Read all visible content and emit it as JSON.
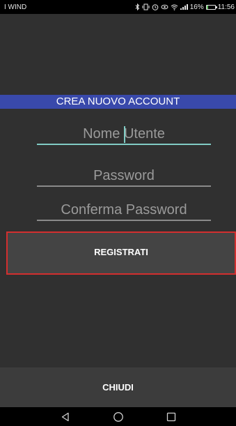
{
  "status_bar": {
    "carrier": "I WIND",
    "battery_percent": "16%",
    "battery_level": 0.16,
    "time": "11:56",
    "icons": [
      "bluetooth-icon",
      "vibrate-icon",
      "alarm-icon",
      "eye-comfort-icon",
      "wifi-icon",
      "signal-icon",
      "battery-icon"
    ]
  },
  "form": {
    "title": "CREA NUOVO ACCOUNT",
    "username_placeholder": "Nome Utente",
    "password_placeholder": "Password",
    "confirm_password_placeholder": "Conferma Password",
    "register_label": "REGISTRATI"
  },
  "footer": {
    "close_label": "CHIUDI"
  },
  "nav": {
    "icons": [
      "back-icon",
      "home-icon",
      "recents-icon"
    ]
  },
  "colors": {
    "banner": "#3949ab",
    "focus_accent": "#80cbc4",
    "register_border": "#d32f2f",
    "background": "#303030"
  }
}
